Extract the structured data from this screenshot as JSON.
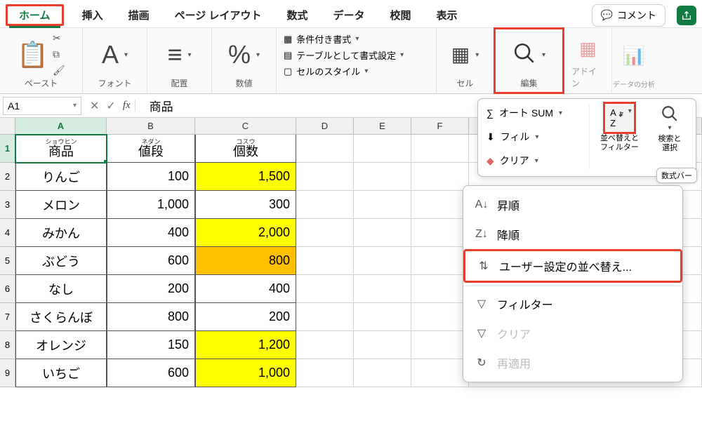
{
  "tabs": {
    "home": "ホーム",
    "insert": "挿入",
    "draw": "描画",
    "layout": "ページ レイアウト",
    "formulas": "数式",
    "data": "データ",
    "review": "校閲",
    "view": "表示"
  },
  "comment_btn": "コメント",
  "ribbon": {
    "paste": "ペースト",
    "font": "フォント",
    "align": "配置",
    "number": "数値",
    "cond_fmt": "条件付き書式",
    "tbl_fmt": "テーブルとして書式設定",
    "cell_style": "セルのスタイル",
    "cell": "セル",
    "edit": "編集",
    "addin": "アドイン",
    "analysis": "データの分析"
  },
  "namebox": "A1",
  "fx": "fx",
  "formula_value": "商品",
  "columns": [
    "A",
    "B",
    "C",
    "D",
    "E",
    "F"
  ],
  "rows": [
    "1",
    "2",
    "3",
    "4",
    "5",
    "6",
    "7",
    "8",
    "9"
  ],
  "hdr": {
    "a_ruby": "ショウヒン",
    "a": "商品",
    "b_ruby": "ネダン",
    "b": "値段",
    "c_ruby": "コスウ",
    "c": "個数"
  },
  "data_rows": [
    {
      "a": "りんご",
      "b": "100",
      "c": "1,500",
      "c_hl": "yellow"
    },
    {
      "a": "メロン",
      "b": "1,000",
      "c": "300",
      "c_hl": ""
    },
    {
      "a": "みかん",
      "b": "400",
      "c": "2,000",
      "c_hl": "yellow"
    },
    {
      "a": "ぶどう",
      "b": "600",
      "c": "800",
      "c_hl": "orange"
    },
    {
      "a": "なし",
      "b": "200",
      "c": "400",
      "c_hl": ""
    },
    {
      "a": "さくらんぼ",
      "b": "800",
      "c": "200",
      "c_hl": ""
    },
    {
      "a": "オレンジ",
      "b": "150",
      "c": "1,200",
      "c_hl": "yellow"
    },
    {
      "a": "いちご",
      "b": "600",
      "c": "1,000",
      "c_hl": "yellow"
    }
  ],
  "edit_panel": {
    "autosum": "オート SUM",
    "fill": "フィル",
    "clear": "クリア",
    "sort_filter": "並べ替えと\nフィルター",
    "find_select": "検索と\n選択",
    "tooltip": "数式バー"
  },
  "ctx": {
    "asc": "昇順",
    "desc": "降順",
    "custom": "ユーザー設定の並べ替え...",
    "filter": "フィルター",
    "clear": "クリア",
    "reapply": "再適用"
  }
}
